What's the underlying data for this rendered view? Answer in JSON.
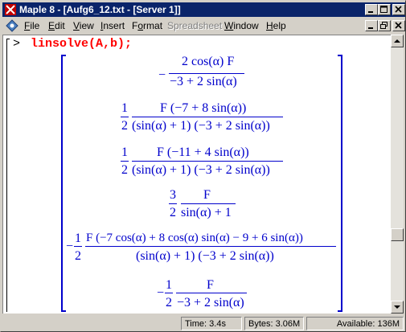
{
  "window": {
    "title": "Maple 8  - [Aufg6_12.txt - [Server 1]]"
  },
  "menubar": {
    "items": [
      {
        "label": "File",
        "key": "F",
        "rest": "ile",
        "enabled": true
      },
      {
        "label": "Edit",
        "key": "E",
        "rest": "dit",
        "enabled": true
      },
      {
        "label": "View",
        "key": "V",
        "rest": "iew",
        "enabled": true
      },
      {
        "label": "Insert",
        "key": "I",
        "rest": "nsert",
        "enabled": true
      },
      {
        "label": "Format",
        "key": "o",
        "rest": "",
        "enabled": true
      },
      {
        "label": "Spreadsheet",
        "key": "",
        "rest": "Spreadsheet",
        "enabled": false
      },
      {
        "label": "Window",
        "key": "W",
        "rest": "indow",
        "enabled": true
      },
      {
        "label": "Help",
        "key": "H",
        "rest": "elp",
        "enabled": true
      }
    ]
  },
  "worksheet": {
    "prompt": ">",
    "command": "linsolve(A,b);",
    "output": [
      {
        "sign": "−",
        "numerator": "2 cos(α) F",
        "denominator": "−3 + 2 sin(α)"
      },
      {
        "coef_num": "1",
        "coef_den": "2",
        "numerator": "F (−7 + 8 sin(α))",
        "denominator": "(sin(α) + 1) (−3 + 2 sin(α))"
      },
      {
        "coef_num": "1",
        "coef_den": "2",
        "numerator": "F (−11 + 4 sin(α))",
        "denominator": "(sin(α) + 1) (−3 + 2 sin(α))"
      },
      {
        "coef_num": "3",
        "coef_den": "2",
        "numerator": "F",
        "denominator": "sin(α) + 1"
      },
      {
        "sign": "−",
        "coef_num": "1",
        "coef_den": "2",
        "numerator": "F (−7 cos(α) + 8 cos(α) sin(α) − 9 + 6 sin(α))",
        "denominator": "(sin(α) + 1) (−3 + 2 sin(α))"
      },
      {
        "sign": "−",
        "coef_num": "1",
        "coef_den": "2",
        "numerator": "F",
        "denominator": "−3 + 2 sin(α)"
      }
    ]
  },
  "statusbar": {
    "time": "Time:   3.4s",
    "bytes": "Bytes: 3.06M",
    "available": "Available: 136M"
  },
  "colors": {
    "titlebar": "#0a246a",
    "input": "#ff0000",
    "output": "#0000cc"
  }
}
